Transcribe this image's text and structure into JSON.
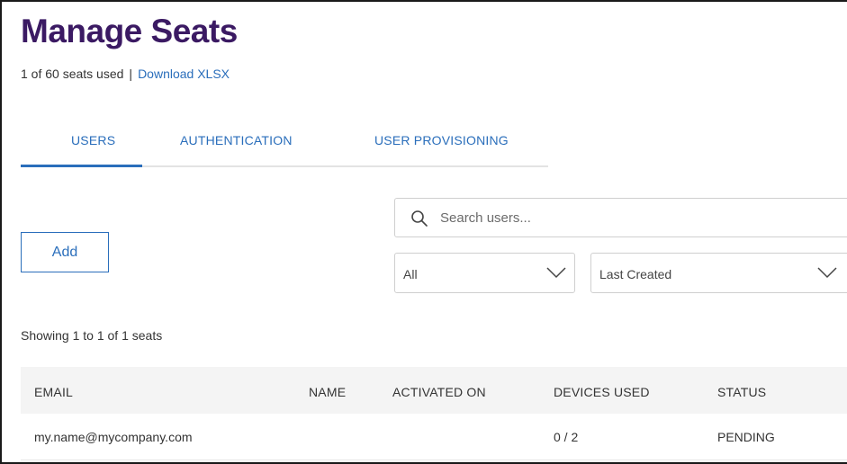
{
  "page": {
    "title": "Manage Seats",
    "seats_used_text": "1 of 60 seats used",
    "separator": "|",
    "download_link": "Download XLSX"
  },
  "tabs": [
    {
      "label": "USERS",
      "active": true
    },
    {
      "label": "AUTHENTICATION",
      "active": false
    },
    {
      "label": "USER PROVISIONING",
      "active": false
    }
  ],
  "toolbar": {
    "add_label": "Add",
    "search_placeholder": "Search users...",
    "filter_value": "All",
    "sort_value": "Last Created"
  },
  "summary": {
    "showing_text": "Showing 1 to 1 of 1 seats"
  },
  "table": {
    "columns": [
      "EMAIL",
      "NAME",
      "ACTIVATED ON",
      "DEVICES USED",
      "STATUS"
    ],
    "rows": [
      {
        "email": "my.name@mycompany.com",
        "name": "",
        "activated_on": "",
        "devices_used": "0 / 2",
        "status": "PENDING"
      }
    ]
  },
  "colors": {
    "title": "#3b1a63",
    "accent": "#2a6ebb",
    "header_bg": "#f4f4f4",
    "border": "#cfcfcf"
  },
  "icons": {
    "search": "search-icon",
    "dropdown": "chevron-down-icon"
  }
}
